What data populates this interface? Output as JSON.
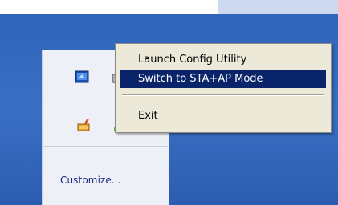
{
  "colors": {
    "desktop_blue": "#3a6fc3",
    "menu_background": "#ece9d8",
    "menu_highlight": "#0a246a",
    "tray_popup_background": "#eef0f7",
    "customize_link": "#1a2a86"
  },
  "tray_popup": {
    "customize_label": "Customize...",
    "icons": [
      "wireless-config-utility-icon",
      "network-connection-icon",
      "partial-tray-icon",
      "status-dot-icon"
    ]
  },
  "context_menu": {
    "items": [
      {
        "label": "Launch Config Utility",
        "highlighted": false
      },
      {
        "label": "Switch to STA+AP Mode",
        "highlighted": true
      },
      {
        "label": "Exit",
        "highlighted": false
      }
    ]
  }
}
